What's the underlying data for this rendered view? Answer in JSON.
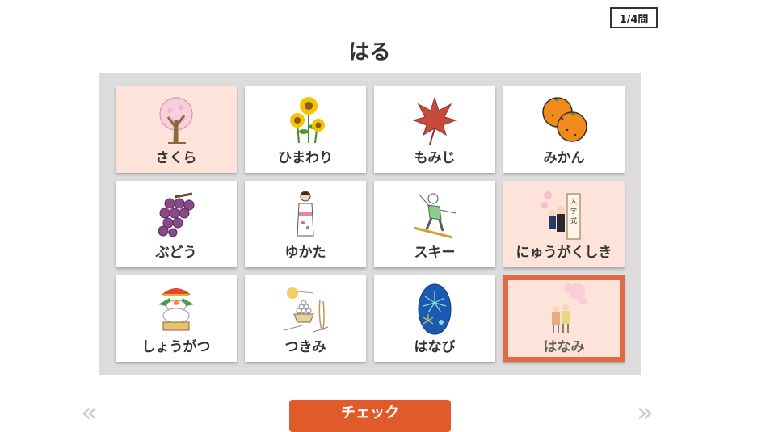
{
  "counter": "1/4問",
  "title": "はる",
  "nav": {
    "prev": "«",
    "next": "»"
  },
  "check_button": "チェック",
  "cards": [
    {
      "label": "さくら",
      "icon": "cherry-tree-icon"
    },
    {
      "label": "ひまわり",
      "icon": "sunflower-icon"
    },
    {
      "label": "もみじ",
      "icon": "maple-leaf-icon"
    },
    {
      "label": "みかん",
      "icon": "mandarin-orange-icon"
    },
    {
      "label": "ぶどう",
      "icon": "grapes-icon"
    },
    {
      "label": "ゆかた",
      "icon": "yukata-woman-icon"
    },
    {
      "label": "スキー",
      "icon": "skier-icon"
    },
    {
      "label": "にゅうがくしき",
      "icon": "entrance-ceremony-icon"
    },
    {
      "label": "しょうがつ",
      "icon": "kagami-mochi-icon"
    },
    {
      "label": "つきみ",
      "icon": "moon-viewing-icon"
    },
    {
      "label": "はなび",
      "icon": "fireworks-icon"
    },
    {
      "label": "はなみ",
      "icon": "hanami-icon"
    }
  ],
  "state": {
    "selected": [
      0,
      7
    ],
    "focused": 11
  },
  "colors": {
    "selected_bg": "#fde3d9",
    "focus_border": "#e06a43",
    "button": "#e05a2a"
  }
}
